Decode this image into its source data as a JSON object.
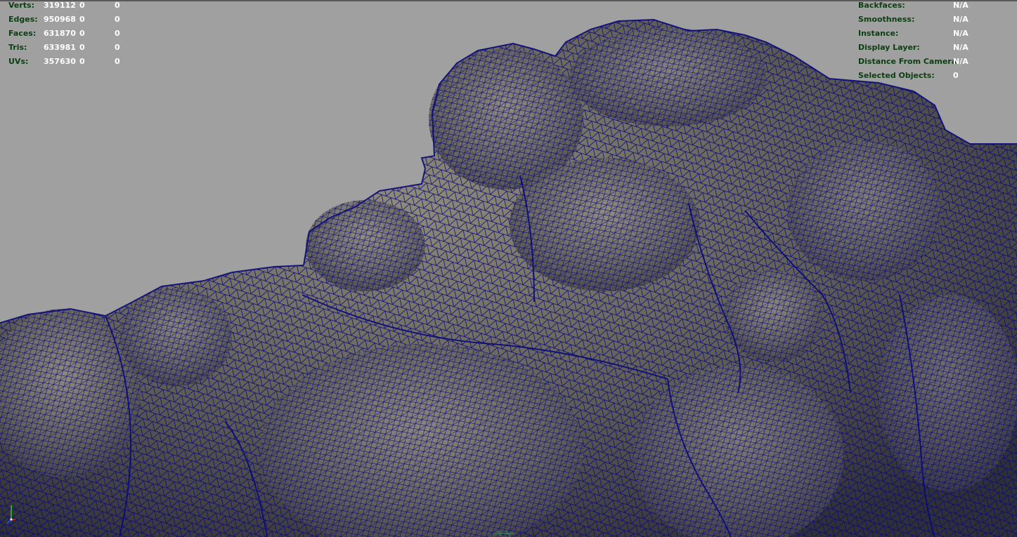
{
  "stats": {
    "rows": [
      {
        "label": "Verts:",
        "values": [
          "319112",
          "0",
          "0"
        ]
      },
      {
        "label": "Edges:",
        "values": [
          "950968",
          "0",
          "0"
        ]
      },
      {
        "label": "Faces:",
        "values": [
          "631870",
          "0",
          "0"
        ]
      },
      {
        "label": "Tris:",
        "values": [
          "633981",
          "0",
          "0"
        ]
      },
      {
        "label": "UVs:",
        "values": [
          "357630",
          "0",
          "0"
        ]
      }
    ]
  },
  "object_info": {
    "rows": [
      {
        "label": "Backfaces:",
        "value": "N/A"
      },
      {
        "label": "Smoothness:",
        "value": "N/A"
      },
      {
        "label": "Instance:",
        "value": "N/A"
      },
      {
        "label": "Display Layer:",
        "value": "N/A"
      },
      {
        "label": "Distance From Camera:",
        "value": "N/A"
      },
      {
        "label": "Selected Objects:",
        "value": "0"
      }
    ]
  },
  "colors": {
    "background": "#a0a0a0",
    "wireframe": "#0a0a7a",
    "hud_label": "#0b3f11",
    "hud_value": "#ffffff"
  },
  "icons": [
    "axis-gizmo-icon",
    "origin-grid-icon"
  ]
}
